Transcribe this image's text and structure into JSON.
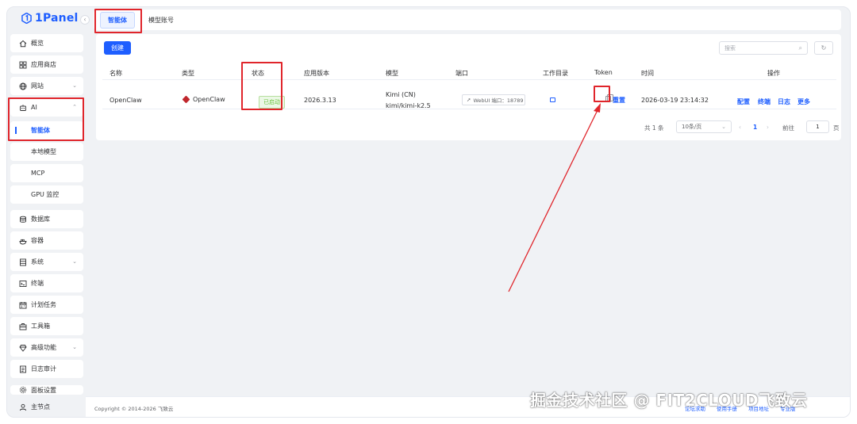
{
  "app": {
    "logo_text": "1Panel",
    "brand_color": "#1e5eff"
  },
  "sidebar": {
    "items": [
      {
        "label": "概览",
        "icon": "home-icon"
      },
      {
        "label": "应用商店",
        "icon": "apps-grid-icon"
      },
      {
        "label": "网站",
        "icon": "globe-icon"
      },
      {
        "label": "AI",
        "icon": "robot-icon"
      },
      {
        "label": "智能体"
      },
      {
        "label": "本地模型"
      },
      {
        "label": "MCP"
      },
      {
        "label": "GPU 监控"
      },
      {
        "label": "数据库",
        "icon": "database-icon"
      },
      {
        "label": "容器",
        "icon": "container-icon"
      },
      {
        "label": "系统",
        "icon": "system-icon"
      },
      {
        "label": "终端",
        "icon": "terminal-icon"
      },
      {
        "label": "计划任务",
        "icon": "calendar-icon"
      },
      {
        "label": "工具箱",
        "icon": "toolbox-icon"
      },
      {
        "label": "高级功能",
        "icon": "diamond-icon"
      },
      {
        "label": "日志审计",
        "icon": "log-icon"
      },
      {
        "label": "面板设置",
        "icon": "settings-icon"
      },
      {
        "label": "主节点",
        "icon": "user-icon"
      }
    ]
  },
  "tabs": [
    {
      "label": "智能体"
    },
    {
      "label": "模型账号"
    }
  ],
  "toolbar": {
    "create_label": "创建",
    "search_placeholder": "搜索"
  },
  "table": {
    "headers": [
      "名称",
      "类型",
      "状态",
      "应用版本",
      "模型",
      "端口",
      "工作目录",
      "Token",
      "时间",
      "操作"
    ],
    "rows": [
      {
        "name": "OpenClaw",
        "type": "OpenClaw",
        "status": "已启动",
        "version": "2026.3.13",
        "model_provider": "Kimi (CN)",
        "model_name": "kimi/kimi-k2.5",
        "port": "WebUI 端口：18789",
        "token_reset": "重置",
        "time": "2026-03-19 23:14:32",
        "actions": [
          "配置",
          "终端",
          "日志",
          "更多"
        ]
      }
    ]
  },
  "pagination": {
    "total": "共 1 条",
    "page_size": "10条/页",
    "current_page": "1",
    "goto_label": "前往",
    "goto_value": "1",
    "page_unit": "页"
  },
  "footer": {
    "copyright": "Copyright © 2014-2026 飞致云",
    "links": [
      "论坛求助",
      "使用手册",
      "项目地址",
      "专业版"
    ]
  },
  "watermark": "掘金技术社区 @ FIT2CLOUD飞致云"
}
